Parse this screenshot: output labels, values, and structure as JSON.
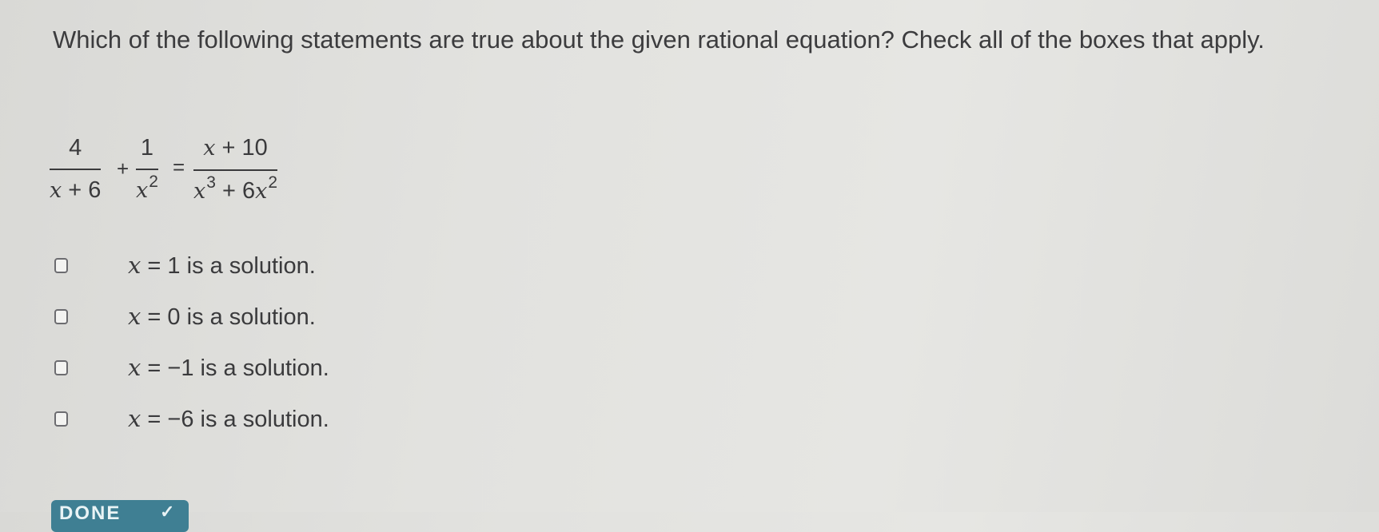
{
  "question": {
    "prompt": "Which of the following statements are true about the given rational equation? Check all of the boxes that apply."
  },
  "equation": {
    "term1": {
      "numerator": "4",
      "den_var": "x",
      "den_rest": " + 6"
    },
    "plus": "+",
    "term2": {
      "numerator": "1",
      "den_var": "x",
      "den_exp": "2"
    },
    "equals": "=",
    "term3": {
      "num_var": "x",
      "num_rest": " + 10",
      "den_var1": "x",
      "den_exp1": "3",
      "den_mid": " + 6",
      "den_var2": "x",
      "den_exp2": "2"
    }
  },
  "options": [
    {
      "var": "x",
      "equals": "=",
      "value": "1",
      "suffix": " is a solution.",
      "checked": false
    },
    {
      "var": "x",
      "equals": "=",
      "value": "0",
      "suffix": " is a solution.",
      "checked": false
    },
    {
      "var": "x",
      "equals": "=",
      "value": "−1",
      "suffix": " is a solution.",
      "checked": false
    },
    {
      "var": "x",
      "equals": "=",
      "value": "−6",
      "suffix": " is a solution.",
      "checked": false
    }
  ],
  "done_button": {
    "label": "DONE",
    "icon": "check-icon"
  },
  "colors": {
    "background": "#e2e2df",
    "text": "#3a3a3c",
    "button": "#3f7f93"
  }
}
